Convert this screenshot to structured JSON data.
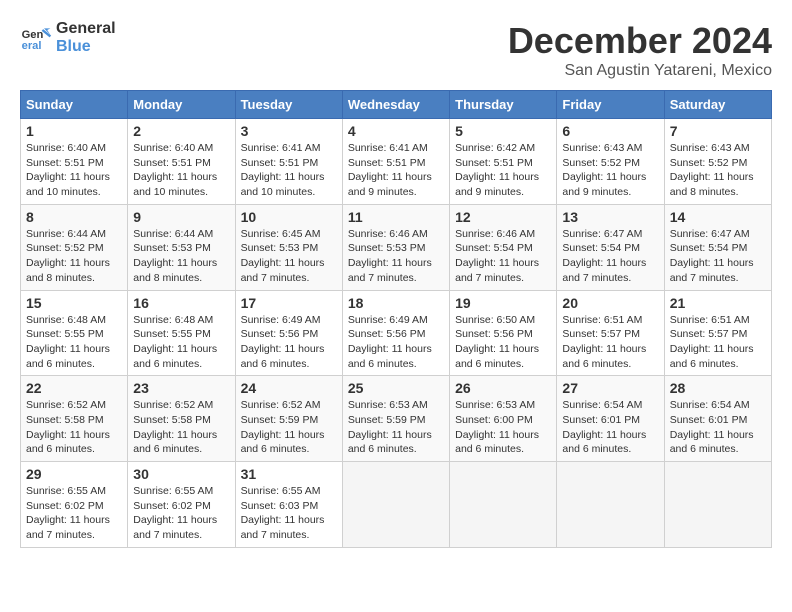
{
  "logo": {
    "line1": "General",
    "line2": "Blue"
  },
  "title": "December 2024",
  "location": "San Agustin Yatareni, Mexico",
  "weekdays": [
    "Sunday",
    "Monday",
    "Tuesday",
    "Wednesday",
    "Thursday",
    "Friday",
    "Saturday"
  ],
  "weeks": [
    [
      {
        "day": "1",
        "sunrise": "Sunrise: 6:40 AM",
        "sunset": "Sunset: 5:51 PM",
        "daylight": "Daylight: 11 hours and 10 minutes."
      },
      {
        "day": "2",
        "sunrise": "Sunrise: 6:40 AM",
        "sunset": "Sunset: 5:51 PM",
        "daylight": "Daylight: 11 hours and 10 minutes."
      },
      {
        "day": "3",
        "sunrise": "Sunrise: 6:41 AM",
        "sunset": "Sunset: 5:51 PM",
        "daylight": "Daylight: 11 hours and 10 minutes."
      },
      {
        "day": "4",
        "sunrise": "Sunrise: 6:41 AM",
        "sunset": "Sunset: 5:51 PM",
        "daylight": "Daylight: 11 hours and 9 minutes."
      },
      {
        "day": "5",
        "sunrise": "Sunrise: 6:42 AM",
        "sunset": "Sunset: 5:51 PM",
        "daylight": "Daylight: 11 hours and 9 minutes."
      },
      {
        "day": "6",
        "sunrise": "Sunrise: 6:43 AM",
        "sunset": "Sunset: 5:52 PM",
        "daylight": "Daylight: 11 hours and 9 minutes."
      },
      {
        "day": "7",
        "sunrise": "Sunrise: 6:43 AM",
        "sunset": "Sunset: 5:52 PM",
        "daylight": "Daylight: 11 hours and 8 minutes."
      }
    ],
    [
      {
        "day": "8",
        "sunrise": "Sunrise: 6:44 AM",
        "sunset": "Sunset: 5:52 PM",
        "daylight": "Daylight: 11 hours and 8 minutes."
      },
      {
        "day": "9",
        "sunrise": "Sunrise: 6:44 AM",
        "sunset": "Sunset: 5:53 PM",
        "daylight": "Daylight: 11 hours and 8 minutes."
      },
      {
        "day": "10",
        "sunrise": "Sunrise: 6:45 AM",
        "sunset": "Sunset: 5:53 PM",
        "daylight": "Daylight: 11 hours and 7 minutes."
      },
      {
        "day": "11",
        "sunrise": "Sunrise: 6:46 AM",
        "sunset": "Sunset: 5:53 PM",
        "daylight": "Daylight: 11 hours and 7 minutes."
      },
      {
        "day": "12",
        "sunrise": "Sunrise: 6:46 AM",
        "sunset": "Sunset: 5:54 PM",
        "daylight": "Daylight: 11 hours and 7 minutes."
      },
      {
        "day": "13",
        "sunrise": "Sunrise: 6:47 AM",
        "sunset": "Sunset: 5:54 PM",
        "daylight": "Daylight: 11 hours and 7 minutes."
      },
      {
        "day": "14",
        "sunrise": "Sunrise: 6:47 AM",
        "sunset": "Sunset: 5:54 PM",
        "daylight": "Daylight: 11 hours and 7 minutes."
      }
    ],
    [
      {
        "day": "15",
        "sunrise": "Sunrise: 6:48 AM",
        "sunset": "Sunset: 5:55 PM",
        "daylight": "Daylight: 11 hours and 6 minutes."
      },
      {
        "day": "16",
        "sunrise": "Sunrise: 6:48 AM",
        "sunset": "Sunset: 5:55 PM",
        "daylight": "Daylight: 11 hours and 6 minutes."
      },
      {
        "day": "17",
        "sunrise": "Sunrise: 6:49 AM",
        "sunset": "Sunset: 5:56 PM",
        "daylight": "Daylight: 11 hours and 6 minutes."
      },
      {
        "day": "18",
        "sunrise": "Sunrise: 6:49 AM",
        "sunset": "Sunset: 5:56 PM",
        "daylight": "Daylight: 11 hours and 6 minutes."
      },
      {
        "day": "19",
        "sunrise": "Sunrise: 6:50 AM",
        "sunset": "Sunset: 5:56 PM",
        "daylight": "Daylight: 11 hours and 6 minutes."
      },
      {
        "day": "20",
        "sunrise": "Sunrise: 6:51 AM",
        "sunset": "Sunset: 5:57 PM",
        "daylight": "Daylight: 11 hours and 6 minutes."
      },
      {
        "day": "21",
        "sunrise": "Sunrise: 6:51 AM",
        "sunset": "Sunset: 5:57 PM",
        "daylight": "Daylight: 11 hours and 6 minutes."
      }
    ],
    [
      {
        "day": "22",
        "sunrise": "Sunrise: 6:52 AM",
        "sunset": "Sunset: 5:58 PM",
        "daylight": "Daylight: 11 hours and 6 minutes."
      },
      {
        "day": "23",
        "sunrise": "Sunrise: 6:52 AM",
        "sunset": "Sunset: 5:58 PM",
        "daylight": "Daylight: 11 hours and 6 minutes."
      },
      {
        "day": "24",
        "sunrise": "Sunrise: 6:52 AM",
        "sunset": "Sunset: 5:59 PM",
        "daylight": "Daylight: 11 hours and 6 minutes."
      },
      {
        "day": "25",
        "sunrise": "Sunrise: 6:53 AM",
        "sunset": "Sunset: 5:59 PM",
        "daylight": "Daylight: 11 hours and 6 minutes."
      },
      {
        "day": "26",
        "sunrise": "Sunrise: 6:53 AM",
        "sunset": "Sunset: 6:00 PM",
        "daylight": "Daylight: 11 hours and 6 minutes."
      },
      {
        "day": "27",
        "sunrise": "Sunrise: 6:54 AM",
        "sunset": "Sunset: 6:01 PM",
        "daylight": "Daylight: 11 hours and 6 minutes."
      },
      {
        "day": "28",
        "sunrise": "Sunrise: 6:54 AM",
        "sunset": "Sunset: 6:01 PM",
        "daylight": "Daylight: 11 hours and 6 minutes."
      }
    ],
    [
      {
        "day": "29",
        "sunrise": "Sunrise: 6:55 AM",
        "sunset": "Sunset: 6:02 PM",
        "daylight": "Daylight: 11 hours and 7 minutes."
      },
      {
        "day": "30",
        "sunrise": "Sunrise: 6:55 AM",
        "sunset": "Sunset: 6:02 PM",
        "daylight": "Daylight: 11 hours and 7 minutes."
      },
      {
        "day": "31",
        "sunrise": "Sunrise: 6:55 AM",
        "sunset": "Sunset: 6:03 PM",
        "daylight": "Daylight: 11 hours and 7 minutes."
      },
      null,
      null,
      null,
      null
    ]
  ]
}
